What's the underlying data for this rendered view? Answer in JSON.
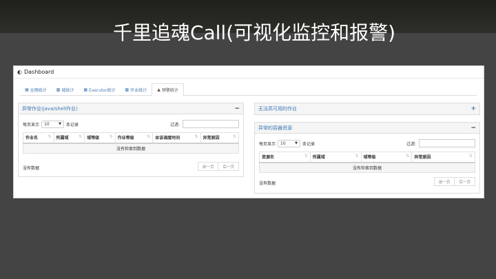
{
  "slide": {
    "title": "千里追魂Call(可视化监控和报警)"
  },
  "navbar": {
    "brand": "Dashboard"
  },
  "tabs": [
    {
      "label": "全网统计"
    },
    {
      "label": "域统计"
    },
    {
      "label": "Executor统计"
    },
    {
      "label": "作业统计"
    },
    {
      "label": "预警统计",
      "active": true
    }
  ],
  "left_panel": {
    "title": "异常作业(java/shell作业)",
    "toggle": "−",
    "length_prefix": "每页显示",
    "length_value": "10",
    "length_suffix": "条记录",
    "filter_label": "过滤:",
    "filter_value": "",
    "columns": [
      "作业名",
      "所属域",
      "域等级",
      "作业等级",
      "本该调度时间",
      "异常原因"
    ],
    "empty_text": "没有检索到数据",
    "info": "没有数据",
    "prev": "前一页",
    "next": "后一页"
  },
  "right_top_panel": {
    "title": "无法高可用的作业",
    "toggle": "+"
  },
  "right_bottom_panel": {
    "title": "异常的容器资源",
    "toggle": "−",
    "length_prefix": "每页显示",
    "length_value": "10",
    "length_suffix": "条记录",
    "filter_label": "过滤:",
    "filter_value": "",
    "columns": [
      "资源名",
      "所属域",
      "域等级",
      "异常原因"
    ],
    "empty_text": "没有检索到数据",
    "info": "没有数据",
    "prev": "前一页",
    "next": "后一页"
  }
}
